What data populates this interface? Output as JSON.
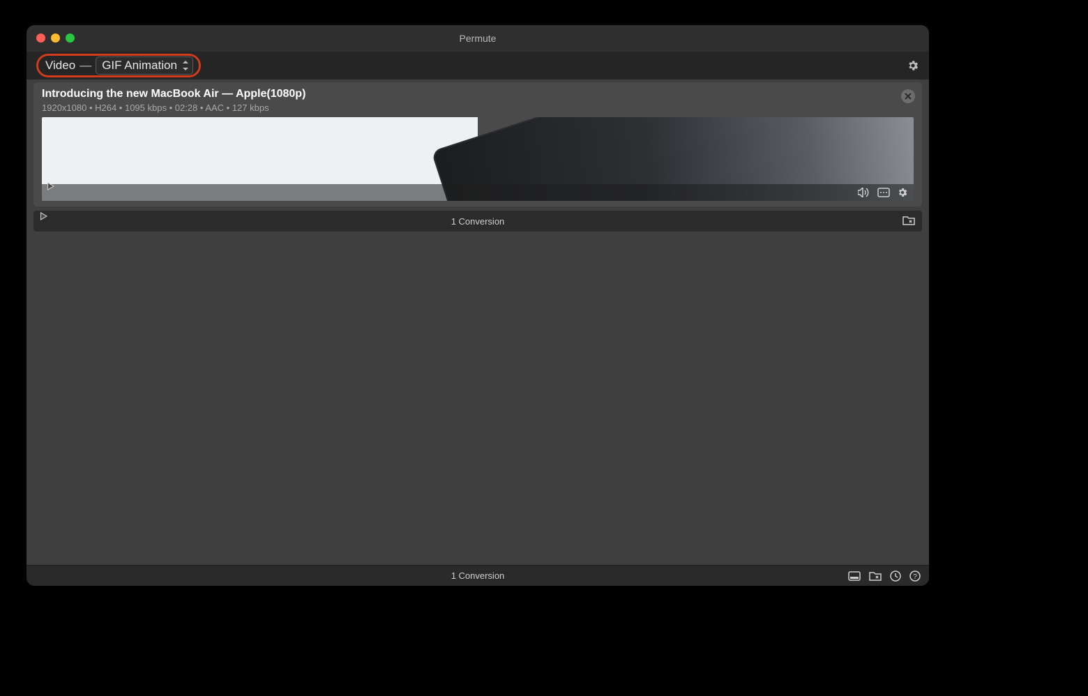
{
  "window": {
    "title": "Permute"
  },
  "toolbar": {
    "format_type": "Video",
    "format_dash": "—",
    "format_preset": "GIF Animation"
  },
  "item": {
    "title": "Introducing the new MacBook Air — Apple(1080p)",
    "meta": "1920x1080 • H264 • 1095 kbps • 02:28 • AAC • 127 kbps"
  },
  "conversion_bar": {
    "label": "1 Conversion"
  },
  "status_bar": {
    "label": "1 Conversion"
  }
}
